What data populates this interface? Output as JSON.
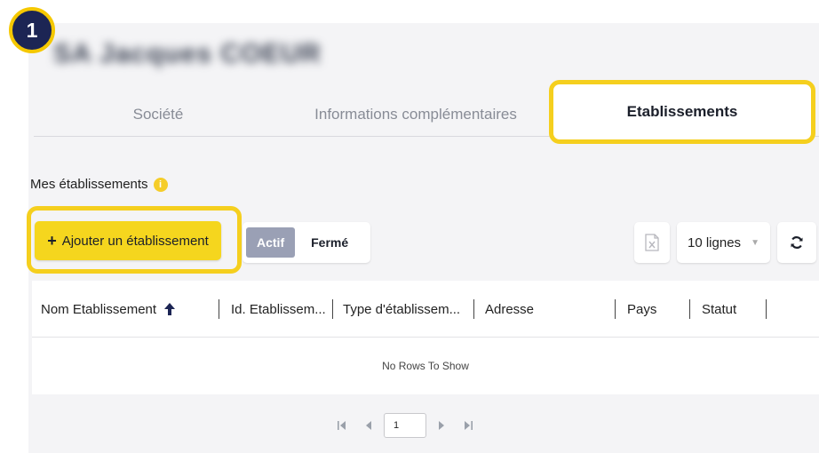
{
  "step_badge": "1",
  "company": {
    "name": "SA Jacques COEUR"
  },
  "tabs": [
    {
      "label": "Société",
      "active": false
    },
    {
      "label": "Informations complémentaires",
      "active": false
    },
    {
      "label": "Etablissements",
      "active": true
    }
  ],
  "section": {
    "title": "Mes établissements",
    "info_icon": "i"
  },
  "toolbar": {
    "add_label": "Ajouter un établissement",
    "toggle_active": "Actif",
    "toggle_closed": "Fermé",
    "rows_select": "10 lignes"
  },
  "grid": {
    "columns": [
      "Nom Etablissement",
      "Id. Etablissem...",
      "Type d'établissem...",
      "Adresse",
      "Pays",
      "Statut"
    ],
    "empty_message": "No Rows To Show"
  },
  "pagination": {
    "current_page": "1"
  },
  "colors": {
    "accent_yellow": "#f5d61e",
    "highlight_border": "#f5cf1e",
    "badge_navy": "#1c2554",
    "toggle_active": "#9aa0b5"
  }
}
